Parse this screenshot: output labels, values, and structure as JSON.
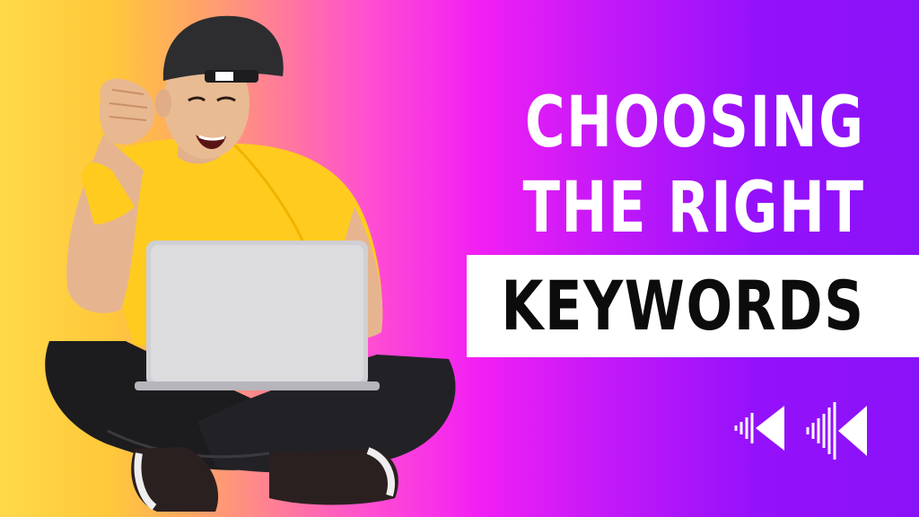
{
  "headline": {
    "line1": "CHOOSING",
    "line2": "THE RIGHT",
    "highlight": "KEYWORDS"
  },
  "icons": [
    "rewind-icon",
    "rewind-icon"
  ],
  "colors": {
    "gradient_left": "#ffd94a",
    "gradient_mid": "#f21ff4",
    "gradient_right": "#8a12f8",
    "title_text": "#ffffff",
    "highlight_band": "#ffffff",
    "highlight_text": "#0c0c0c"
  }
}
